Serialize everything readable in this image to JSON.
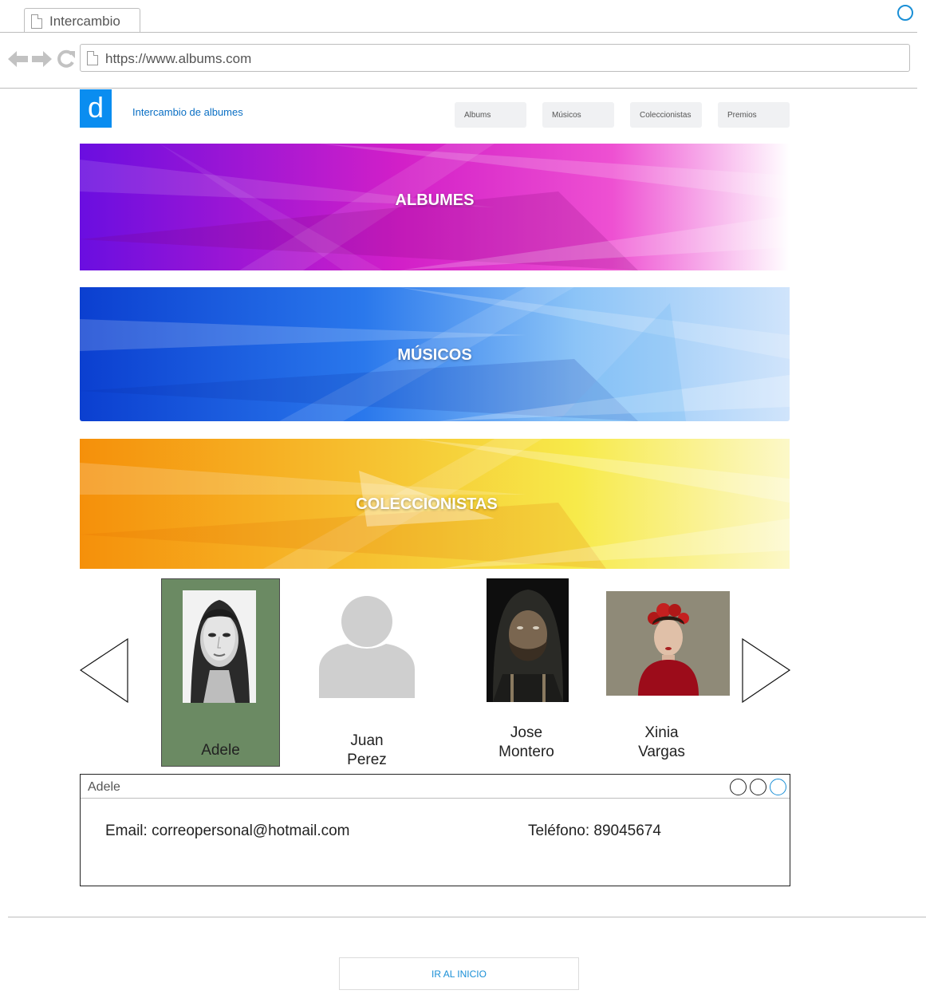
{
  "browser": {
    "tab_title": "Intercambio",
    "url": "https://www.albums.com"
  },
  "header": {
    "logo_letter": "d",
    "site_title": "Intercambio de albumes",
    "menu": [
      "Albums",
      "Músicos",
      "Coleccionistas",
      "Premios"
    ]
  },
  "banners": [
    {
      "label": "ALBUMES",
      "colors": [
        "#6a0ee0",
        "#e020c0",
        "#ffffff"
      ]
    },
    {
      "label": "MÚSICOS",
      "colors": [
        "#0b3fd0",
        "#3aa0f0",
        "#d0e4fb"
      ]
    },
    {
      "label": "COLECCIONISTAS",
      "colors": [
        "#f5900a",
        "#f7e640",
        "#fcf8c8"
      ]
    }
  ],
  "carousel": {
    "people": [
      {
        "name_line1": "Adele",
        "name_line2": "",
        "selected": true
      },
      {
        "name_line1": "Juan",
        "name_line2": "Perez",
        "selected": false
      },
      {
        "name_line1": "Jose",
        "name_line2": "Montero",
        "selected": false
      },
      {
        "name_line1": "Xinia",
        "name_line2": "Vargas",
        "selected": false
      }
    ],
    "selected_color": "#6b8a63"
  },
  "detail": {
    "title": "Adele",
    "email": "Email: correopersonal@hotmail.com",
    "phone": "Teléfono: 89045674"
  },
  "footer": {
    "home_button": "IR AL INICIO"
  }
}
